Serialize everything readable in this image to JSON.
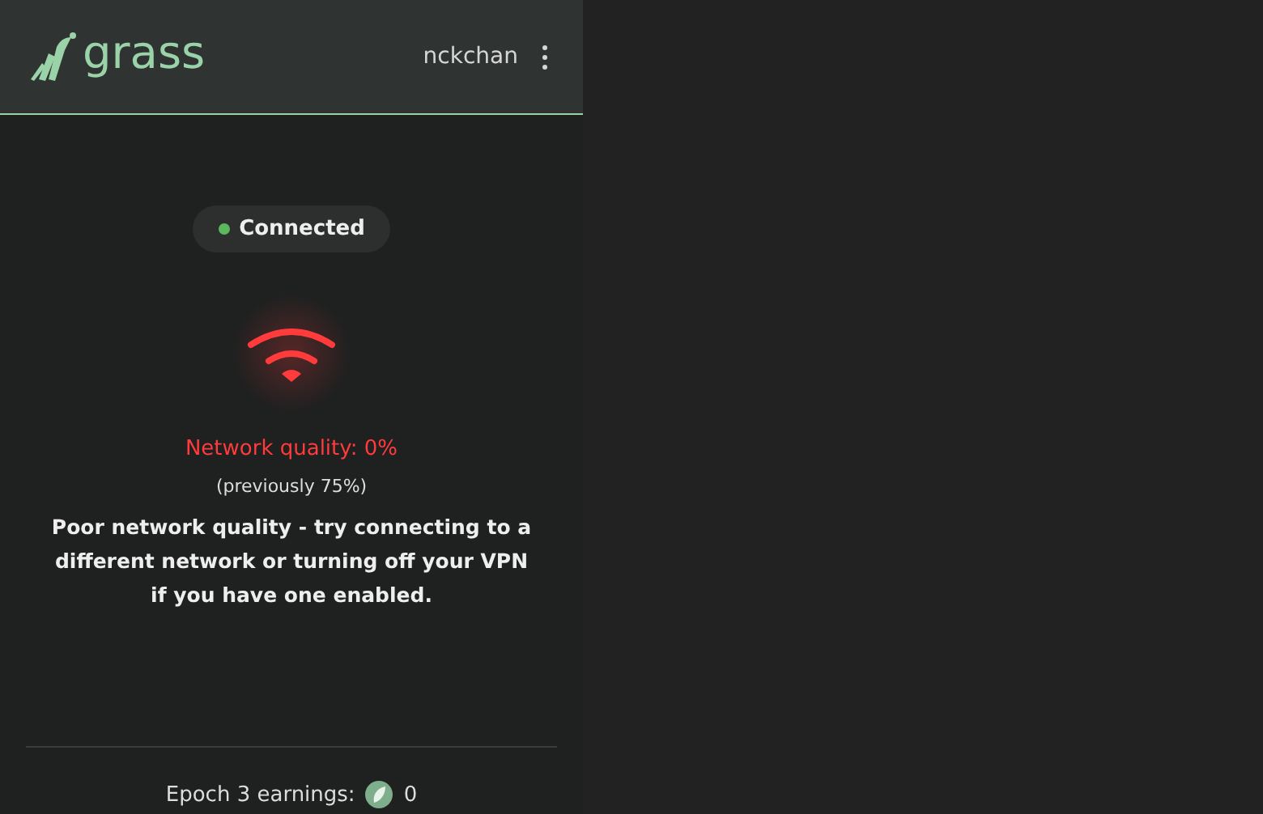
{
  "header": {
    "logo_text": "grass",
    "username": "nckchan"
  },
  "status": {
    "label": "Connected",
    "color": "#5cb85c"
  },
  "network": {
    "kind": "poor",
    "quality": "Network quality: 0%",
    "previous": "(previously 75%)",
    "message": "Poor network quality - try connecting to a different network or turning off your VPN if you have one enabled."
  },
  "earnings": {
    "label": "Epoch 3 earnings:",
    "value": "0"
  }
}
